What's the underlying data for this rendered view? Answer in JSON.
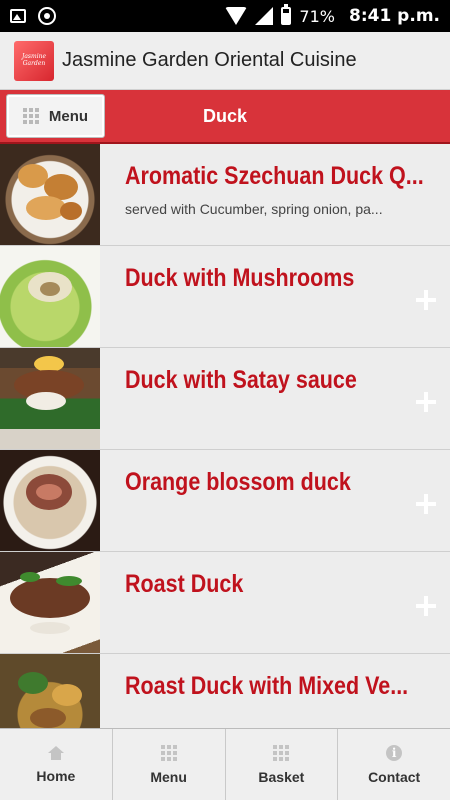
{
  "status_bar": {
    "battery": "71%",
    "time": "8:41 p.m.",
    "icons": [
      "image-icon",
      "target-icon",
      "wifi-icon",
      "signal-icon",
      "battery-icon"
    ]
  },
  "app": {
    "title": "Jasmine Garden Oriental Cuisine",
    "logo_text": "Jasmine Garden"
  },
  "header": {
    "menu_label": "Menu",
    "title": "Duck"
  },
  "items": [
    {
      "title": "Aromatic Szechuan Duck Q...",
      "description": "served with Cucumber, spring onion, pa..."
    },
    {
      "title": "Duck with Mushrooms",
      "description": ""
    },
    {
      "title": "Duck with Satay sauce",
      "description": ""
    },
    {
      "title": "Orange blossom duck",
      "description": ""
    },
    {
      "title": "Roast Duck",
      "description": ""
    },
    {
      "title": "Roast Duck with Mixed Ve...",
      "description": ""
    }
  ],
  "bottom_nav": [
    {
      "label": "Home",
      "icon": "home-icon"
    },
    {
      "label": "Menu",
      "icon": "grid-icon"
    },
    {
      "label": "Basket",
      "icon": "grid-icon"
    },
    {
      "label": "Contact",
      "icon": "info-icon"
    }
  ],
  "colors": {
    "accent": "#d8333a",
    "item_title": "#c0121d",
    "list_bg": "#ededed"
  }
}
